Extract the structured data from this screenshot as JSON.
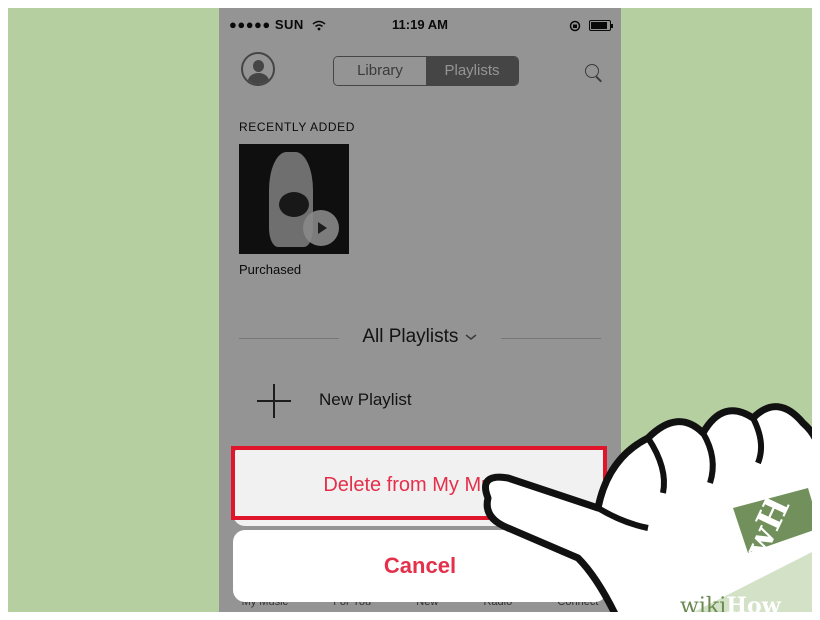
{
  "status_bar": {
    "carrier": "●●●●● SUN",
    "time": "11:19 AM",
    "wifi_icon": "wifi-icon",
    "battery_icon": "battery-icon"
  },
  "nav": {
    "segments": [
      "Library",
      "Playlists"
    ],
    "selected": "Playlists"
  },
  "recently_added": {
    "title": "RECENTLY ADDED",
    "album_caption": "Purchased"
  },
  "all_playlists": {
    "label": "All Playlists"
  },
  "new_playlist": {
    "label": "New Playlist"
  },
  "tab_bar": {
    "items": [
      "My Music",
      "For You",
      "New",
      "Radio",
      "Connect"
    ]
  },
  "action_sheet": {
    "delete_label": "Delete from My Music",
    "cancel_label": "Cancel"
  },
  "watermark": {
    "wiki": "wiki",
    "how": "How",
    "logo_letters": "wH"
  },
  "colors": {
    "background": "#b5cfa0",
    "accent": "#e5304b",
    "highlight": "#e0142a"
  }
}
